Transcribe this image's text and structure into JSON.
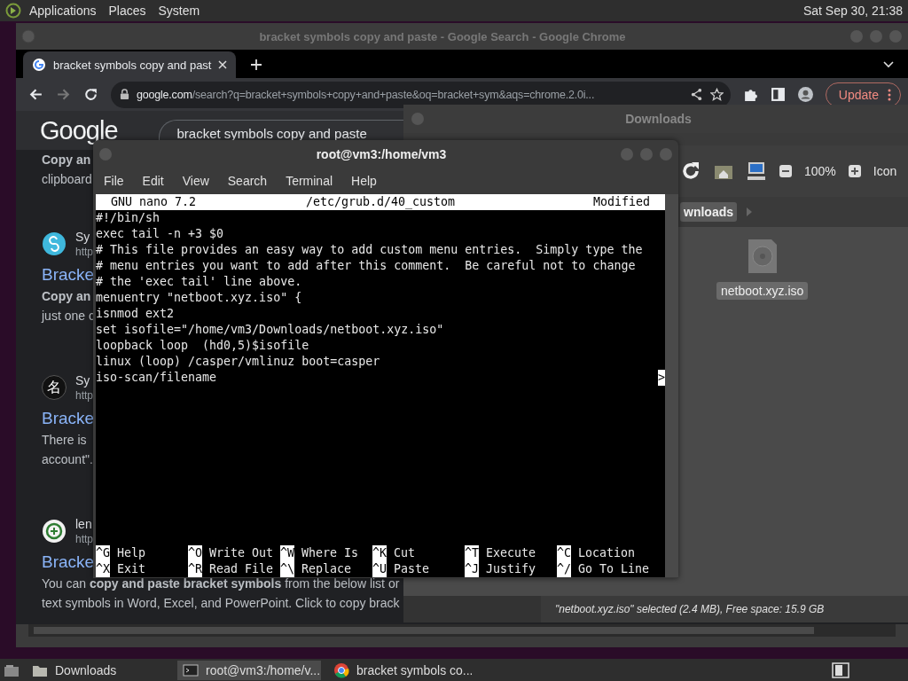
{
  "top_panel": {
    "menus": [
      "Applications",
      "Places",
      "System"
    ],
    "clock": "Sat Sep 30, 21:38"
  },
  "browser": {
    "title": "bracket symbols copy and paste - Google Search - Google Chrome",
    "tabs": [
      {
        "label": "bracket symbols copy and past",
        "selected": true
      }
    ],
    "address": {
      "host": "google.com",
      "path": "/search?q=bracket+symbols+copy+and+paste&oq=bracket+sym&aqs=chrome.2.0i..."
    },
    "update_button": "Update",
    "page": {
      "logo": "Google",
      "search_value": "bracket symbols copy and paste",
      "top_snippet": [
        {
          "text": "Copy an",
          "bold": true
        },
        {
          "text": "clipboard",
          "bold": false
        }
      ],
      "results": [
        {
          "favicon": {
            "kind": "swirl"
          },
          "site": "Sy",
          "url": "http",
          "title": "Bracke",
          "snippet": [
            {
              "text": "Copy an",
              "bold": true
            },
            {
              "text": "just one c",
              "bold": false
            }
          ]
        },
        {
          "favicon": {
            "kind": "glyph",
            "glyph": "名"
          },
          "site": "Sy",
          "url": "http",
          "title": "Bracke",
          "snippet": [
            {
              "text": "There is",
              "bold": false
            },
            {
              "text": "account\".",
              "bold": false
            }
          ]
        },
        {
          "favicon": {
            "kind": "emblem"
          },
          "site": "len",
          "url": "http",
          "title": "Bracke",
          "snippet": [
            {
              "text": "You can **copy and paste bracket symbols** from the below list or",
              "bold": false
            },
            {
              "text": "text symbols in Word, Excel, and PowerPoint. Click to copy brack",
              "bold": false
            }
          ]
        }
      ]
    }
  },
  "files": {
    "title": "Downloads",
    "zoom": "100%",
    "view": "Icon",
    "path_button": "wnloads",
    "items": [
      {
        "name": "netboot.xyz.iso",
        "selected": true
      }
    ],
    "status": "\"netboot.xyz.iso\" selected (2.4 MB), Free space: 15.9 GB"
  },
  "terminal": {
    "title": "root@vm3:/home/vm3",
    "menus": [
      "File",
      "Edit",
      "View",
      "Search",
      "Terminal",
      "Help"
    ],
    "nano": {
      "version": "GNU nano 7.2",
      "file": "/etc/grub.d/40_custom",
      "state": "Modified",
      "lines": [
        {
          "text": "#!/bin/sh"
        },
        {
          "text": "exec tail -n +3 $0"
        },
        {
          "text": "# This file provides an easy way to add custom menu entries.  Simply type the"
        },
        {
          "text": "# menu entries you want to add after this comment.  Be careful not to change"
        },
        {
          "text": "# the 'exec tail' line above."
        },
        {
          "text": "menuentry \"netboot.xyz.iso\" {"
        },
        {
          "text": "isnmod ext2"
        },
        {
          "text": "set isofile=\"/home/vm3/Downloads/netboot.xyz.iso\""
        },
        {
          "text": "loopback loop  (hd0,5)$isofile"
        },
        {
          "text": "linux (loop) /casper/vmlinuz boot=casper"
        },
        {
          "text": "iso-scan/filename",
          "continues": ">"
        }
      ],
      "shortcuts": [
        [
          {
            "key": "^G",
            "label": "Help"
          },
          {
            "key": "^O",
            "label": "Write Out"
          },
          {
            "key": "^W",
            "label": "Where Is"
          },
          {
            "key": "^K",
            "label": "Cut"
          },
          {
            "key": "^T",
            "label": "Execute"
          },
          {
            "key": "^C",
            "label": "Location"
          }
        ],
        [
          {
            "key": "^X",
            "label": "Exit"
          },
          {
            "key": "^R",
            "label": "Read File"
          },
          {
            "key": "^\\",
            "label": "Replace"
          },
          {
            "key": "^U",
            "label": "Paste"
          },
          {
            "key": "^J",
            "label": "Justify"
          },
          {
            "key": "^/",
            "label": "Go To Line"
          }
        ]
      ]
    }
  },
  "taskbar": {
    "items": [
      {
        "kind": "folder",
        "label": "Downloads",
        "selected": false
      },
      {
        "kind": "terminal",
        "label": "root@vm3:/home/v...",
        "selected": true
      },
      {
        "kind": "browser",
        "label": "bracket symbols co...",
        "selected": false
      }
    ]
  }
}
